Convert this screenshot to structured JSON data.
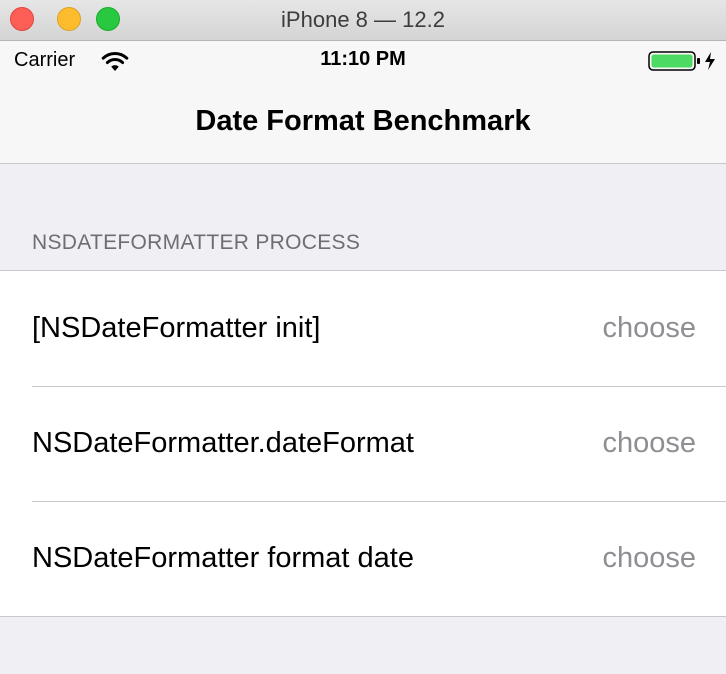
{
  "window": {
    "title": "iPhone 8 — 12.2"
  },
  "status_bar": {
    "carrier": "Carrier",
    "time": "11:10 PM",
    "icons": [
      "wifi-icon",
      "battery-charging-icon"
    ],
    "battery_color": "#4cd964"
  },
  "nav": {
    "title": "Date Format Benchmark"
  },
  "section": {
    "header": "NSDATEFORMATTER PROCESS",
    "rows": [
      {
        "title": "[NSDateFormatter init]",
        "detail": "choose"
      },
      {
        "title": "NSDateFormatter.dateFormat",
        "detail": "choose"
      },
      {
        "title": "NSDateFormatter format date",
        "detail": "choose"
      }
    ]
  }
}
